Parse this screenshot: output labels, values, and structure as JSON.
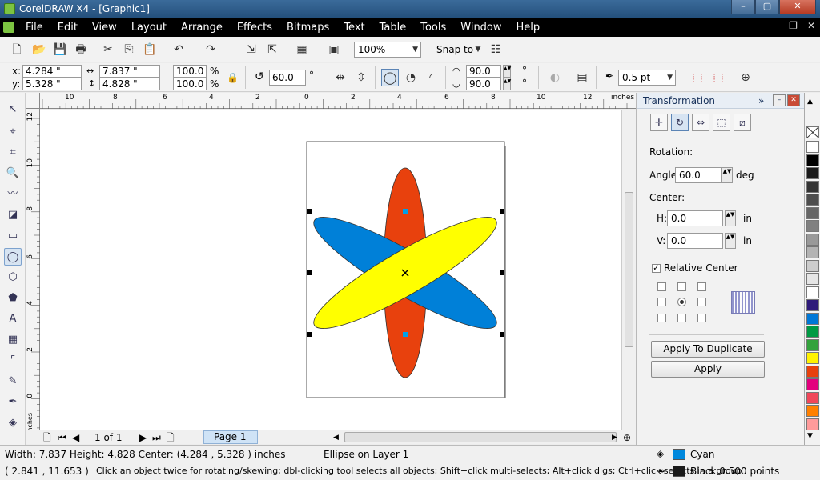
{
  "window": {
    "title": "CorelDRAW X4 - [Graphic1]",
    "minimize": "–",
    "maximize": "▢",
    "close": "✕"
  },
  "menu": [
    "File",
    "Edit",
    "View",
    "Layout",
    "Arrange",
    "Effects",
    "Bitmaps",
    "Text",
    "Table",
    "Tools",
    "Window",
    "Help"
  ],
  "standard_toolbar": {
    "zoom": "100%",
    "snap_to": "Snap to"
  },
  "property_bar": {
    "x_label": "x:",
    "x": "4.284 \"",
    "y_label": "y:",
    "y": "5.328 \"",
    "width": "7.837 \"",
    "height": "4.828 \"",
    "scale_x": "100.0",
    "scale_y": "100.0",
    "percent": "%",
    "rotation": "60.0",
    "degree": "°",
    "arc_start": "90.0",
    "arc_end": "90.0",
    "outline": "0.5 pt"
  },
  "ruler": {
    "units": "inches",
    "h_labels": [
      "10",
      "8",
      "6",
      "4",
      "2",
      "0",
      "2",
      "4",
      "6",
      "8",
      "10",
      "12"
    ],
    "v_labels": [
      "12",
      "10",
      "8",
      "6",
      "4",
      "2",
      "0"
    ],
    "v_units": "inches"
  },
  "page_nav": {
    "count": "1 of 1",
    "tab": "Page 1"
  },
  "docker": {
    "title": "Transformation",
    "rotation_label": "Rotation:",
    "angle_label": "Angle:",
    "angle": "60.0",
    "angle_unit": "deg",
    "center_label": "Center:",
    "h_label": "H:",
    "h": "0.0",
    "h_unit": "in",
    "v_label": "V:",
    "v": "0.0",
    "v_unit": "in",
    "relative_center": "Relative Center",
    "relative_center_checked": true,
    "apply_to_duplicate": "Apply To Duplicate",
    "apply": "Apply"
  },
  "palette": [
    "#ffffff",
    "#000000",
    "#1a1a1a",
    "#333333",
    "#4d4d4d",
    "#666666",
    "#808080",
    "#999999",
    "#b3b3b3",
    "#cccccc",
    "#e6e6e6",
    "#ffffff",
    "#2e1a7a",
    "#0078d7",
    "#009a44",
    "#33a23c",
    "#fff200",
    "#e8410d",
    "#e3007d",
    "#f0475a",
    "#ff8000",
    "#ff9b9b"
  ],
  "status": {
    "dimensions": "Width: 7.837  Height: 4.828  Center: (4.284 , 5.328 )  inches",
    "object_info": "Ellipse on Layer 1",
    "coords": "( 2.841 , 11.653 )",
    "hint": "Click an object twice for rotating/skewing; dbl-clicking tool selects all objects; Shift+click multi-selects; Alt+click digs; Ctrl+click selects in a group",
    "fill_name": "Cyan",
    "fill_color": "#0088dd",
    "outline_name": "Black  0.500 points",
    "outline_color": "#1a1a1a"
  },
  "colors": {
    "red_ellipse": "#e8410d",
    "blue_ellipse": "#0080d8",
    "yellow_ellipse": "#ffff00"
  }
}
